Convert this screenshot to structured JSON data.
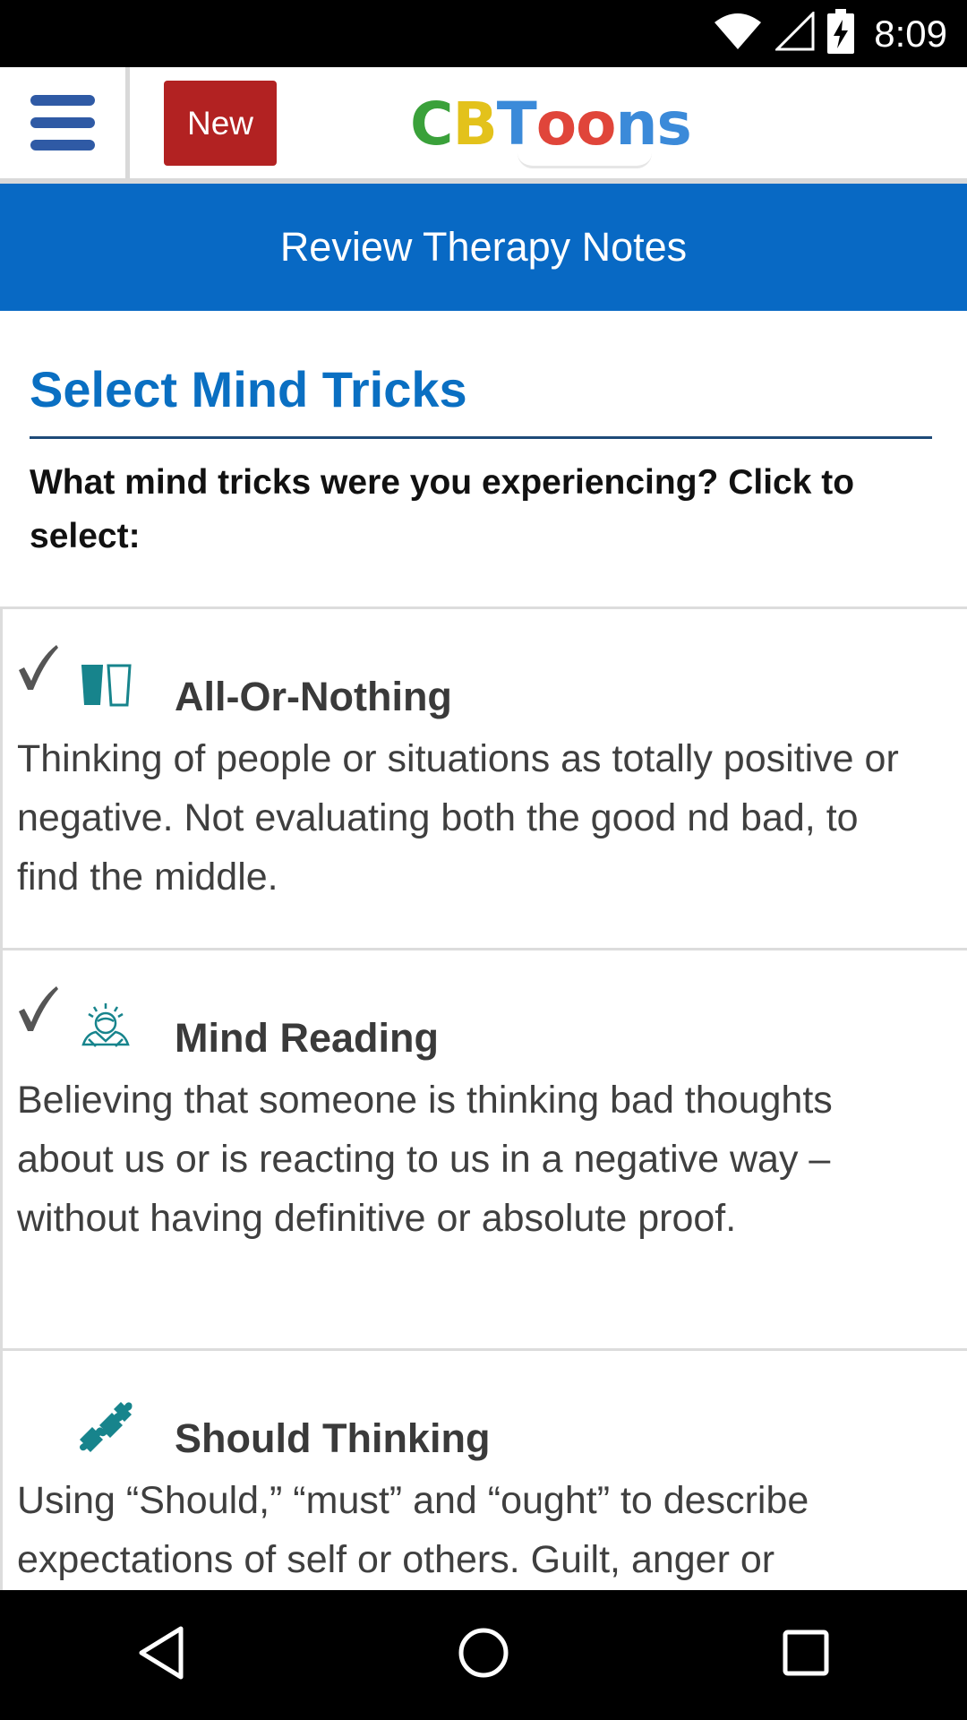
{
  "status_bar": {
    "time": "8:09",
    "icons": [
      "wifi-icon",
      "signal-icon",
      "battery-charging-icon"
    ]
  },
  "header": {
    "menu_icon": "hamburger-menu-icon",
    "new_button_label": "New",
    "logo_letters": [
      {
        "char": "C",
        "color": "#3aa13a"
      },
      {
        "char": "B",
        "color": "#e3c21b"
      },
      {
        "char": "T",
        "color": "#3b8ad9"
      },
      {
        "char": "o",
        "color": "#e0453a"
      },
      {
        "char": "o",
        "color": "#e0453a"
      },
      {
        "char": "n",
        "color": "#3b8ad9"
      },
      {
        "char": "s",
        "color": "#3b8ad9"
      }
    ]
  },
  "banner": {
    "title": "Review Therapy Notes",
    "color": "#0869c4"
  },
  "main": {
    "heading": "Select Mind Tricks",
    "instruction": "What mind tricks were you experiencing? Click to select:",
    "tricks": [
      {
        "title": "All-Or-Nothing",
        "description": "Thinking of people or situations as totally positive or negative. Not evaluating both the good nd bad, to find the middle.",
        "selected": true,
        "icon": "two-glasses-icon"
      },
      {
        "title": "Mind Reading",
        "description": "Believing that someone is thinking bad thoughts about us or is reacting to us in a negative way – without having definitive or absolute proof.",
        "selected": true,
        "icon": "mind-reader-icon"
      },
      {
        "title": "Should Thinking",
        "description": "Using “Should,” “must” and “ought” to describe expectations of self or others. Guilt, anger or",
        "selected": false,
        "icon": "puzzle-pieces-icon"
      }
    ]
  },
  "nav_bar": {
    "icons": [
      "back-icon",
      "home-icon",
      "recents-icon"
    ]
  }
}
